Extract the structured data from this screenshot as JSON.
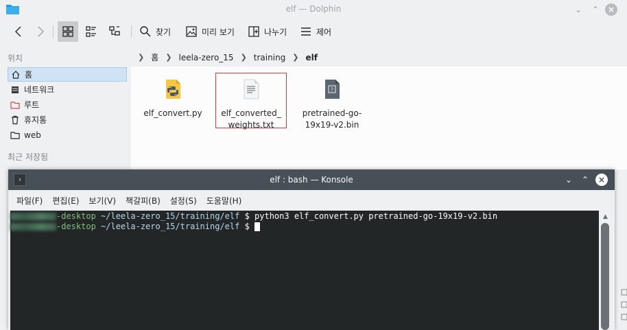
{
  "dolphin": {
    "title": "elf — Dolphin",
    "toolbar": {
      "find": "찾기",
      "preview": "미리 보기",
      "split": "나누기",
      "control": "제어"
    },
    "sidebar": {
      "places_header": "위치",
      "items": [
        {
          "label": "홈",
          "icon": "home-icon"
        },
        {
          "label": "네트워크",
          "icon": "network-icon"
        },
        {
          "label": "루트",
          "icon": "folder-red-icon"
        },
        {
          "label": "휴지통",
          "icon": "trash-icon"
        },
        {
          "label": "web",
          "icon": "folder-icon"
        }
      ],
      "recent_header": "최근 저장됨"
    },
    "breadcrumb": [
      "홈",
      "leela-zero_15",
      "training",
      "elf"
    ],
    "files": [
      {
        "name_line1": "elf_convert.py",
        "name_line2": "",
        "icon": "python-file-icon"
      },
      {
        "name_line1": "elf_converted_",
        "name_line2": "weights.txt",
        "icon": "text-file-icon"
      },
      {
        "name_line1": "pretrained-go-",
        "name_line2": "19x19-v2.bin",
        "icon": "binary-file-icon"
      }
    ]
  },
  "konsole": {
    "title": "elf : bash — Konsole",
    "menu": [
      "파일(F)",
      "편집(E)",
      "보기(V)",
      "책갈피(B)",
      "설정(S)",
      "도움말(H)"
    ],
    "lines": [
      {
        "host": "-desktop",
        "path": "~/leela-zero_15/training/elf",
        "prompt": "$",
        "command": "python3 elf_convert.py pretrained-go-19x19-v2.bin"
      },
      {
        "host": "-desktop",
        "path": "~/leela-zero_15/training/elf",
        "prompt": "$",
        "command": ""
      }
    ]
  },
  "colors": {
    "konsole_titlebar": "#475057",
    "terminal_bg": "#232627",
    "selection": "#cfe3f4",
    "highlight_border": "#d13a3a"
  }
}
